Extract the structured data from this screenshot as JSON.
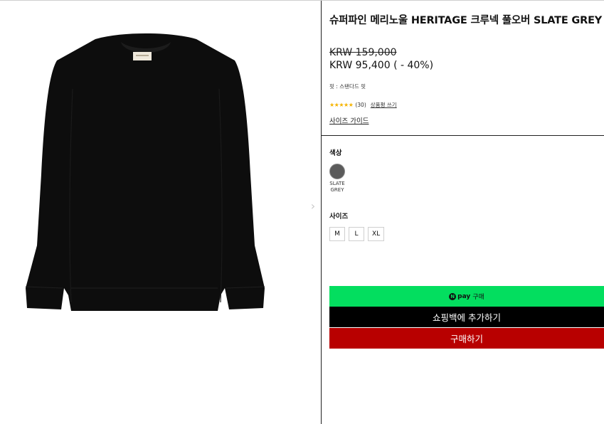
{
  "product": {
    "title": "슈퍼파인 메리노울 HERITAGE 크루넥 풀오버 SLATE GREY",
    "price_original": "KRW 159,000",
    "price_sale": "KRW 95,400 ( - 40%)",
    "fit": "핏 : 스탠다드 핏",
    "rating": {
      "stars": "★★★★★",
      "count": "(30)",
      "review_link": "상품평 쓰기"
    },
    "size_guide": "사이즈 가이드",
    "image_color": "#0d0d0d"
  },
  "gallery": {
    "next_icon": "chevron-right-icon",
    "next_glyph": "›"
  },
  "color": {
    "heading": "색상",
    "swatches": [
      {
        "label": "SLATE GREY",
        "hex": "#5b5b5b"
      }
    ]
  },
  "size": {
    "heading": "사이즈",
    "options": [
      "M",
      "L",
      "XL"
    ]
  },
  "buttons": {
    "npay_n": "N",
    "npay_word": "pay",
    "npay_label": "구매",
    "add_to_bag": "쇼핑백에 추가하기",
    "buy_now": "구매하기"
  },
  "colors": {
    "npay_green": "#03de5f",
    "bag_black": "#000000",
    "buy_red": "#b80000",
    "star_yellow": "#f5b400"
  }
}
